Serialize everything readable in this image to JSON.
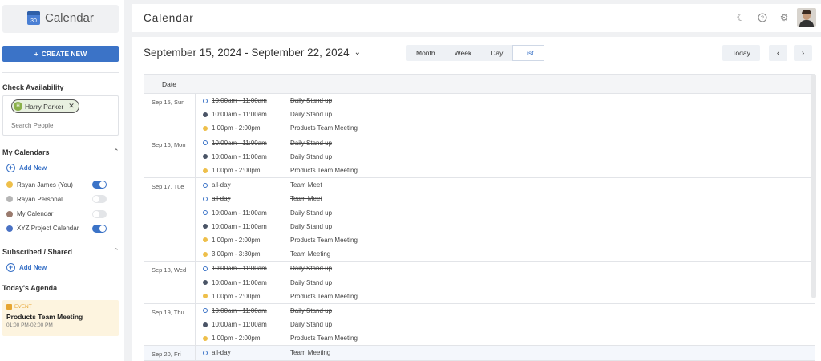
{
  "app": {
    "name": "Calendar",
    "logo_number": "30"
  },
  "sidebar": {
    "create_label": "CREATE NEW",
    "availability": {
      "title": "Check Availability",
      "chip_initial": "H",
      "chip_name": "Harry Parker",
      "search_placeholder": "Search People"
    },
    "my_calendars": {
      "title": "My Calendars",
      "add_label": "Add New",
      "items": [
        {
          "label": "Rayan James (You)",
          "color": "#eebf4a",
          "enabled": true
        },
        {
          "label": "Rayan Personal",
          "color": "#b5b5b5",
          "enabled": false
        },
        {
          "label": "My Calendar",
          "color": "#9a7b6e",
          "enabled": false
        },
        {
          "label": "XYZ Project Calendar",
          "color": "#4a72c4",
          "enabled": true
        }
      ]
    },
    "subscribed": {
      "title": "Subscribed / Shared",
      "add_label": "Add New"
    },
    "agenda": {
      "title": "Today's Agenda",
      "event_type": "EVENT",
      "event_title": "Products Team Meeting",
      "event_time": "01:00 PM-02:00 PM"
    }
  },
  "header": {
    "title": "Calendar",
    "icons": [
      "moon-icon",
      "help-icon",
      "gear-icon"
    ]
  },
  "main": {
    "range_title": "September 15, 2024 - September 22, 2024",
    "views": [
      "Month",
      "Week",
      "Day",
      "List"
    ],
    "active_view": "List",
    "today_label": "Today",
    "prev_symbol": "‹",
    "next_symbol": "›",
    "table_header": "Date",
    "days": [
      {
        "date": "Sep 15, Sun",
        "events": [
          {
            "time": "10:00am - 11:00am",
            "title": "Daily Stand up",
            "marker": "hollow",
            "struck": true
          },
          {
            "time": "10:00am - 11:00am",
            "title": "Daily Stand up",
            "marker": "dark",
            "struck": false
          },
          {
            "time": "1:00pm - 2:00pm",
            "title": "Products Team Meeting",
            "marker": "yellow",
            "struck": false
          }
        ]
      },
      {
        "date": "Sep 16, Mon",
        "events": [
          {
            "time": "10:00am - 11:00am",
            "title": "Daily Stand up",
            "marker": "hollow",
            "struck": true
          },
          {
            "time": "10:00am - 11:00am",
            "title": "Daily Stand up",
            "marker": "dark",
            "struck": false
          },
          {
            "time": "1:00pm - 2:00pm",
            "title": "Products Team Meeting",
            "marker": "yellow",
            "struck": false
          }
        ]
      },
      {
        "date": "Sep 17, Tue",
        "events": [
          {
            "time": "all-day",
            "title": "Team Meet",
            "marker": "hollow",
            "struck": false
          },
          {
            "time": "all-day",
            "title": "Team Meet",
            "marker": "hollow",
            "struck": true
          },
          {
            "time": "10:00am - 11:00am",
            "title": "Daily Stand up",
            "marker": "hollow",
            "struck": true
          },
          {
            "time": "10:00am - 11:00am",
            "title": "Daily Stand up",
            "marker": "dark",
            "struck": false
          },
          {
            "time": "1:00pm - 2:00pm",
            "title": "Products Team Meeting",
            "marker": "yellow",
            "struck": false
          },
          {
            "time": "3:00pm - 3:30pm",
            "title": "Team Meeting",
            "marker": "yellow",
            "struck": false
          }
        ]
      },
      {
        "date": "Sep 18, Wed",
        "events": [
          {
            "time": "10:00am - 11:00am",
            "title": "Daily Stand up",
            "marker": "hollow",
            "struck": true
          },
          {
            "time": "10:00am - 11:00am",
            "title": "Daily Stand up",
            "marker": "dark",
            "struck": false
          },
          {
            "time": "1:00pm - 2:00pm",
            "title": "Products Team Meeting",
            "marker": "yellow",
            "struck": false
          }
        ]
      },
      {
        "date": "Sep 19, Thu",
        "events": [
          {
            "time": "10:00am - 11:00am",
            "title": "Daily Stand up",
            "marker": "hollow",
            "struck": true
          },
          {
            "time": "10:00am - 11:00am",
            "title": "Daily Stand up",
            "marker": "dark",
            "struck": false
          },
          {
            "time": "1:00pm - 2:00pm",
            "title": "Products Team Meeting",
            "marker": "yellow",
            "struck": false
          }
        ]
      },
      {
        "date": "Sep 20, Fri",
        "shaded": true,
        "events": [
          {
            "time": "all-day",
            "title": "Team Meeting",
            "marker": "hollow",
            "struck": false
          }
        ]
      }
    ]
  }
}
